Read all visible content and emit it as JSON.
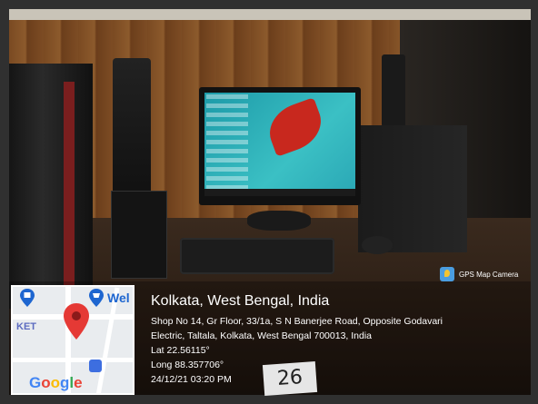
{
  "location": {
    "title": "Kolkata, West Bengal, India",
    "address_line1": "Shop No 14, Gr Floor, 33/1a, S N Banerjee Road, Opposite Godavari",
    "address_line2": "Electric, Taltala, Kolkata, West Bengal 700013, India",
    "lat": "Lat 22.56115°",
    "long": "Long 88.357706°",
    "timestamp": "24/12/21 03:20 PM"
  },
  "badge": {
    "label": "GPS Map Camera",
    "icon": "gps-map-camera-icon"
  },
  "map": {
    "label_left": "KET",
    "label_right": "Wel",
    "brand": [
      "G",
      "o",
      "o",
      "g",
      "l",
      "e"
    ],
    "pin_color": "#e53935",
    "marker_color": "#1e66d0"
  },
  "scene": {
    "tag_number": "26"
  }
}
